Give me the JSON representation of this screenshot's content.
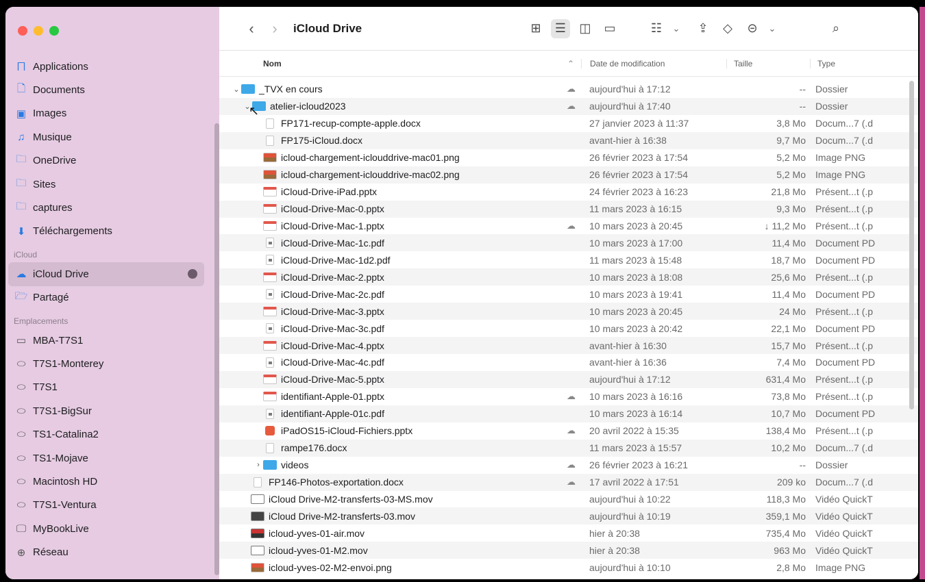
{
  "window": {
    "title": "iCloud Drive"
  },
  "toolbar": {
    "back_icon": "chevron-left",
    "forward_icon": "chevron-right",
    "title": "iCloud Drive"
  },
  "sidebar": {
    "favorites": [
      {
        "label": "Applications",
        "icon": "applications-icon"
      },
      {
        "label": "Documents",
        "icon": "document-icon"
      },
      {
        "label": "Images",
        "icon": "images-icon"
      },
      {
        "label": "Musique",
        "icon": "music-icon"
      },
      {
        "label": "OneDrive",
        "icon": "folder-icon"
      },
      {
        "label": "Sites",
        "icon": "folder-icon"
      },
      {
        "label": "captures",
        "icon": "folder-icon"
      },
      {
        "label": "Téléchargements",
        "icon": "download-icon"
      }
    ],
    "icloud_section": "iCloud",
    "icloud": [
      {
        "label": "iCloud Drive",
        "icon": "cloud-icon"
      },
      {
        "label": "Partagé",
        "icon": "shared-folder-icon"
      }
    ],
    "locations_section": "Emplacements",
    "locations": [
      {
        "label": "MBA-T7S1",
        "icon": "laptop-icon"
      },
      {
        "label": "T7S1-Monterey",
        "icon": "disk-icon"
      },
      {
        "label": "T7S1",
        "icon": "disk-icon"
      },
      {
        "label": "T7S1-BigSur",
        "icon": "disk-icon"
      },
      {
        "label": "TS1-Catalina2",
        "icon": "disk-icon"
      },
      {
        "label": "TS1-Mojave",
        "icon": "disk-icon"
      },
      {
        "label": "Macintosh HD",
        "icon": "disk-icon"
      },
      {
        "label": "T7S1-Ventura",
        "icon": "disk-icon"
      },
      {
        "label": "MyBookLive",
        "icon": "display-icon"
      },
      {
        "label": "Réseau",
        "icon": "network-icon"
      }
    ]
  },
  "columns": {
    "name": "Nom",
    "date": "Date de modification",
    "size": "Taille",
    "type": "Type"
  },
  "files": [
    {
      "name": "_TVX en cours",
      "date": "aujourd'hui à 17:12",
      "size": "--",
      "type": "Dossier"
    },
    {
      "name": "atelier-icloud2023",
      "date": "aujourd'hui à 17:40",
      "size": "--",
      "type": "Dossier"
    },
    {
      "name": "FP171-recup-compte-apple.docx",
      "date": "27 janvier 2023 à 11:37",
      "size": "3,8 Mo",
      "type": "Docum...7 (.d"
    },
    {
      "name": "FP175-iCloud.docx",
      "date": "avant-hier à 16:38",
      "size": "9,7 Mo",
      "type": "Docum...7 (.d"
    },
    {
      "name": "icloud-chargement-iclouddrive-mac01.png",
      "date": "26 février 2023 à 17:54",
      "size": "5,2 Mo",
      "type": "Image PNG"
    },
    {
      "name": "icloud-chargement-iclouddrive-mac02.png",
      "date": "26 février 2023 à 17:54",
      "size": "5,2 Mo",
      "type": "Image PNG"
    },
    {
      "name": "iCloud-Drive-iPad.pptx",
      "date": "24 février 2023 à 16:23",
      "size": "21,8 Mo",
      "type": "Présent...t (.p"
    },
    {
      "name": "iCloud-Drive-Mac-0.pptx",
      "date": "11 mars 2023 à 16:15",
      "size": "9,3 Mo",
      "type": "Présent...t (.p"
    },
    {
      "name": "iCloud-Drive-Mac-1.pptx",
      "date": "10 mars 2023 à 20:45",
      "size": "↓ 11,2 Mo",
      "type": "Présent...t (.p"
    },
    {
      "name": "iCloud-Drive-Mac-1c.pdf",
      "date": "10 mars 2023 à 17:00",
      "size": "11,4 Mo",
      "type": "Document PD"
    },
    {
      "name": "iCloud-Drive-Mac-1d2.pdf",
      "date": "11 mars 2023 à 15:48",
      "size": "18,7 Mo",
      "type": "Document PD"
    },
    {
      "name": "iCloud-Drive-Mac-2.pptx",
      "date": "10 mars 2023 à 18:08",
      "size": "25,6 Mo",
      "type": "Présent...t (.p"
    },
    {
      "name": "iCloud-Drive-Mac-2c.pdf",
      "date": "10 mars 2023 à 19:41",
      "size": "11,4 Mo",
      "type": "Document PD"
    },
    {
      "name": "iCloud-Drive-Mac-3.pptx",
      "date": "10 mars 2023 à 20:45",
      "size": "24 Mo",
      "type": "Présent...t (.p"
    },
    {
      "name": "iCloud-Drive-Mac-3c.pdf",
      "date": "10 mars 2023 à 20:42",
      "size": "22,1 Mo",
      "type": "Document PD"
    },
    {
      "name": "iCloud-Drive-Mac-4.pptx",
      "date": "avant-hier à 16:30",
      "size": "15,7 Mo",
      "type": "Présent...t (.p"
    },
    {
      "name": "iCloud-Drive-Mac-4c.pdf",
      "date": "avant-hier à 16:36",
      "size": "7,4 Mo",
      "type": "Document PD"
    },
    {
      "name": "iCloud-Drive-Mac-5.pptx",
      "date": "aujourd'hui à 17:12",
      "size": "631,4 Mo",
      "type": "Présent...t (.p"
    },
    {
      "name": "identifiant-Apple-01.pptx",
      "date": "10 mars 2023 à 16:16",
      "size": "73,8 Mo",
      "type": "Présent...t (.p"
    },
    {
      "name": "identifiant-Apple-01c.pdf",
      "date": "10 mars 2023 à 16:14",
      "size": "10,7 Mo",
      "type": "Document PD"
    },
    {
      "name": "iPadOS15-iCloud-Fichiers.pptx",
      "date": "20 avril 2022 à 15:35",
      "size": "138,4 Mo",
      "type": "Présent...t (.p"
    },
    {
      "name": "rampe176.docx",
      "date": "11 mars 2023 à 15:57",
      "size": "10,2 Mo",
      "type": "Docum...7 (.d"
    },
    {
      "name": "videos",
      "date": "26 février 2023 à 16:21",
      "size": "--",
      "type": "Dossier"
    },
    {
      "name": "FP146-Photos-exportation.docx",
      "date": "17 avril 2022 à 17:51",
      "size": "209 ko",
      "type": "Docum...7 (.d"
    },
    {
      "name": "iCloud Drive-M2-transferts-03-MS.mov",
      "date": "aujourd'hui à 10:22",
      "size": "118,3 Mo",
      "type": "Vidéo QuickT"
    },
    {
      "name": "iCloud Drive-M2-transferts-03.mov",
      "date": "aujourd'hui à 10:19",
      "size": "359,1 Mo",
      "type": "Vidéo QuickT"
    },
    {
      "name": "icloud-yves-01-air.mov",
      "date": "hier à 20:38",
      "size": "735,4 Mo",
      "type": "Vidéo QuickT"
    },
    {
      "name": "icloud-yves-01-M2.mov",
      "date": "hier à 20:38",
      "size": "963 Mo",
      "type": "Vidéo QuickT"
    },
    {
      "name": "icloud-yves-02-M2-envoi.png",
      "date": "aujourd'hui à 10:10",
      "size": "2,8 Mo",
      "type": "Image PNG"
    }
  ],
  "colors": {
    "sidebar_bg": "#e6cbe2",
    "accent": "#2a7ae2",
    "folder": "#3ea8e8"
  }
}
